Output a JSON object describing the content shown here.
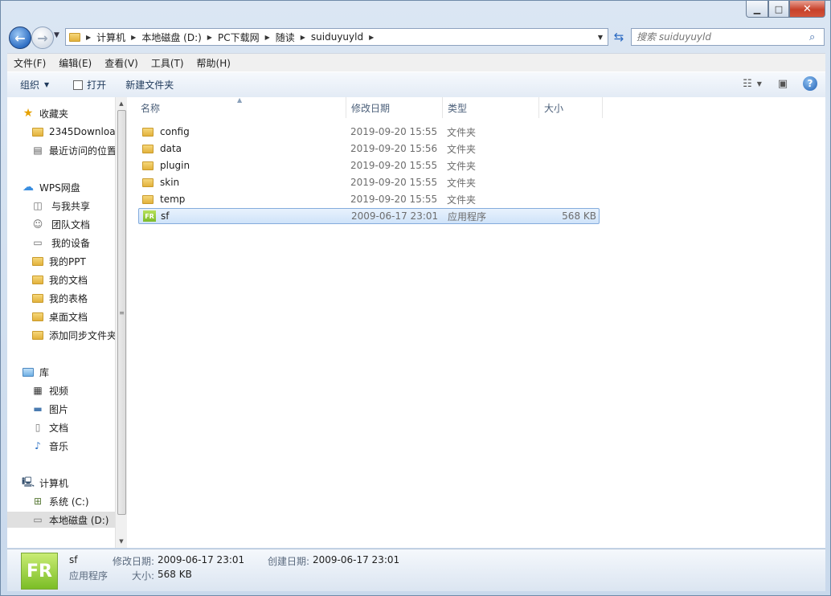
{
  "window": {
    "min": "▭",
    "max": "□",
    "close": "✕"
  },
  "address": {
    "crumbs": [
      "计算机",
      "本地磁盘 (D:)",
      "PC下载网",
      "随读",
      "suiduyuyld"
    ]
  },
  "search": {
    "placeholder": "搜索 suiduyuyld"
  },
  "menu": [
    "文件(F)",
    "编辑(E)",
    "查看(V)",
    "工具(T)",
    "帮助(H)"
  ],
  "toolbar": {
    "organize": "组织",
    "open": "打开",
    "new_folder": "新建文件夹"
  },
  "sidebar": {
    "favorites": "收藏夹",
    "fav_items": [
      "2345Downloa",
      "最近访问的位置"
    ],
    "wps": "WPS网盘",
    "wps_items": [
      "与我共享",
      "团队文档",
      "我的设备",
      "我的PPT",
      "我的文档",
      "我的表格",
      "桌面文档",
      "添加同步文件夹"
    ],
    "library": "库",
    "lib_items": [
      "视频",
      "图片",
      "文档",
      "音乐"
    ],
    "computer": "计算机",
    "comp_items": [
      "系统 (C:)",
      "本地磁盘 (D:)"
    ]
  },
  "columns": {
    "name": "名称",
    "date": "修改日期",
    "type": "类型",
    "size": "大小"
  },
  "files": [
    {
      "name": "config",
      "date": "2019-09-20 15:55",
      "type": "文件夹",
      "size": ""
    },
    {
      "name": "data",
      "date": "2019-09-20 15:56",
      "type": "文件夹",
      "size": ""
    },
    {
      "name": "plugin",
      "date": "2019-09-20 15:55",
      "type": "文件夹",
      "size": ""
    },
    {
      "name": "skin",
      "date": "2019-09-20 15:55",
      "type": "文件夹",
      "size": ""
    },
    {
      "name": "temp",
      "date": "2019-09-20 15:55",
      "type": "文件夹",
      "size": ""
    },
    {
      "name": "sf",
      "date": "2009-06-17 23:01",
      "type": "应用程序",
      "size": "568 KB"
    }
  ],
  "status": {
    "name": "sf",
    "type": "应用程序",
    "modified_label": "修改日期:",
    "modified": "2009-06-17 23:01",
    "created_label": "创建日期:",
    "created": "2009-06-17 23:01",
    "size_label": "大小:",
    "size": "568 KB",
    "icon_text": "FR"
  },
  "icon_text_small": "FR"
}
